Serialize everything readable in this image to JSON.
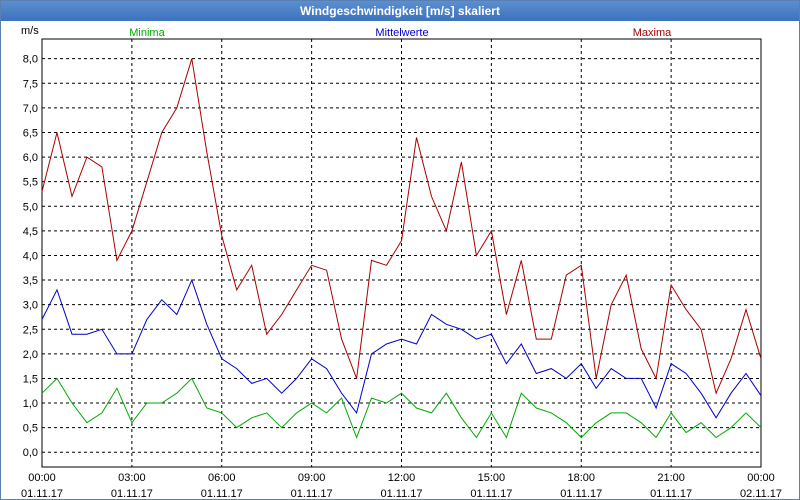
{
  "window": {
    "title": "Windgeschwindigkeit [m/s] skaliert"
  },
  "chart_data": {
    "type": "line",
    "title": "Windgeschwindigkeit [m/s] skaliert",
    "ylabel": "m/s",
    "xlabel": "",
    "ylim": [
      -0.3,
      8.4
    ],
    "xlim": [
      0,
      24
    ],
    "y_ticks": [
      "0,0",
      "0,5",
      "1,0",
      "1,5",
      "2,0",
      "2,5",
      "3,0",
      "3,5",
      "4,0",
      "4,5",
      "5,0",
      "5,5",
      "6,0",
      "6,5",
      "7,0",
      "7,5",
      "8,0"
    ],
    "x_ticks": [
      {
        "time": "00:00",
        "date": "01.11.17"
      },
      {
        "time": "03:00",
        "date": "01.11.17"
      },
      {
        "time": "06:00",
        "date": "01.11.17"
      },
      {
        "time": "09:00",
        "date": "01.11.17"
      },
      {
        "time": "12:00",
        "date": "01.11.17"
      },
      {
        "time": "15:00",
        "date": "01.11.17"
      },
      {
        "time": "18:00",
        "date": "01.11.17"
      },
      {
        "time": "21:00",
        "date": "01.11.17"
      },
      {
        "time": "00:00",
        "date": "02.11.17"
      }
    ],
    "grid": true,
    "legend_position": "top",
    "series": [
      {
        "name": "Minima",
        "color": "#00aa00",
        "x": [
          0,
          0.5,
          1,
          1.5,
          2,
          2.5,
          3,
          3.5,
          4,
          4.5,
          5,
          5.5,
          6,
          6.5,
          7,
          7.5,
          8,
          8.5,
          9,
          9.5,
          10,
          10.5,
          11,
          11.5,
          12,
          12.5,
          13,
          13.5,
          14,
          14.5,
          15,
          15.5,
          16,
          16.5,
          17,
          17.5,
          18,
          18.5,
          19,
          19.5,
          20,
          20.5,
          21,
          21.5,
          22,
          22.5,
          23,
          23.5,
          24
        ],
        "values": [
          1.2,
          1.5,
          1.0,
          0.6,
          0.8,
          1.3,
          0.6,
          1.0,
          1.0,
          1.2,
          1.5,
          0.9,
          0.8,
          0.5,
          0.7,
          0.8,
          0.5,
          0.8,
          1.0,
          0.8,
          1.1,
          0.3,
          1.1,
          1.0,
          1.2,
          0.9,
          0.8,
          1.2,
          0.7,
          0.3,
          0.8,
          0.3,
          1.2,
          0.9,
          0.8,
          0.6,
          0.3,
          0.6,
          0.8,
          0.8,
          0.6,
          0.3,
          0.8,
          0.4,
          0.6,
          0.3,
          0.5,
          0.8,
          0.5
        ]
      },
      {
        "name": "Mittelwerte",
        "color": "#0000cc",
        "x": [
          0,
          0.5,
          1,
          1.5,
          2,
          2.5,
          3,
          3.5,
          4,
          4.5,
          5,
          5.5,
          6,
          6.5,
          7,
          7.5,
          8,
          8.5,
          9,
          9.5,
          10,
          10.5,
          11,
          11.5,
          12,
          12.5,
          13,
          13.5,
          14,
          14.5,
          15,
          15.5,
          16,
          16.5,
          17,
          17.5,
          18,
          18.5,
          19,
          19.5,
          20,
          20.5,
          21,
          21.5,
          22,
          22.5,
          23,
          23.5,
          24
        ],
        "values": [
          2.7,
          3.3,
          2.4,
          2.4,
          2.5,
          2.0,
          2.0,
          2.7,
          3.1,
          2.8,
          3.5,
          2.6,
          1.9,
          1.7,
          1.4,
          1.5,
          1.2,
          1.5,
          1.9,
          1.7,
          1.2,
          0.8,
          2.0,
          2.2,
          2.3,
          2.2,
          2.8,
          2.6,
          2.5,
          2.3,
          2.4,
          1.8,
          2.2,
          1.6,
          1.7,
          1.5,
          1.8,
          1.3,
          1.7,
          1.5,
          1.5,
          0.9,
          1.8,
          1.6,
          1.2,
          0.7,
          1.2,
          1.6,
          1.15
        ]
      },
      {
        "name": "Maxima",
        "color": "#aa0000",
        "x": [
          0,
          0.5,
          1,
          1.5,
          2,
          2.5,
          3,
          3.5,
          4,
          4.5,
          5,
          5.5,
          6,
          6.5,
          7,
          7.5,
          8,
          8.5,
          9,
          9.5,
          10,
          10.5,
          11,
          11.5,
          12,
          12.5,
          13,
          13.5,
          14,
          14.5,
          15,
          15.5,
          16,
          16.5,
          17,
          17.5,
          18,
          18.5,
          19,
          19.5,
          20,
          20.5,
          21,
          21.5,
          22,
          22.5,
          23,
          23.5,
          24
        ],
        "values": [
          5.3,
          6.5,
          5.2,
          6.0,
          5.8,
          3.9,
          4.5,
          5.5,
          6.5,
          7.0,
          8.0,
          6.1,
          4.4,
          3.3,
          3.8,
          2.4,
          2.8,
          3.3,
          3.8,
          3.7,
          2.3,
          1.5,
          3.9,
          3.8,
          4.3,
          6.4,
          5.2,
          4.5,
          5.9,
          4.0,
          4.5,
          2.8,
          3.9,
          2.3,
          2.3,
          3.6,
          3.8,
          1.5,
          3.0,
          3.6,
          2.1,
          1.5,
          3.4,
          2.9,
          2.5,
          1.2,
          1.9,
          2.9,
          1.9
        ]
      }
    ]
  }
}
